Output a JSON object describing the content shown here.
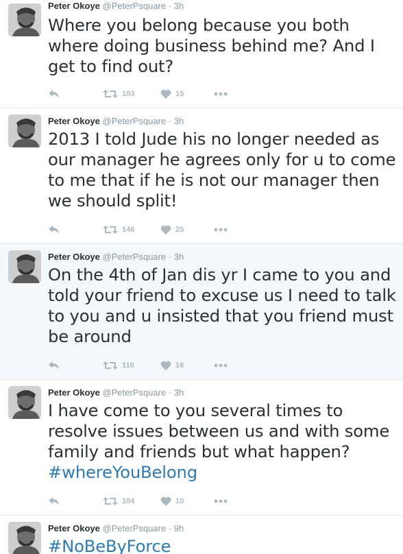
{
  "tweets": [
    {
      "fullname": "Peter Okoye",
      "username": "@PeterPsquare",
      "separator": "·",
      "time": "3h",
      "text": "Where you belong because you both where doing business behind me? And I get to find out?",
      "hashtag": "",
      "retweets": "103",
      "likes": "15"
    },
    {
      "fullname": "Peter Okoye",
      "username": "@PeterPsquare",
      "separator": "·",
      "time": "3h",
      "text": "2013 I told Jude his no longer needed as our manager he agrees only for u to come to me that if he is not our manager then we should split!",
      "hashtag": "",
      "retweets": "146",
      "likes": "25"
    },
    {
      "fullname": "Peter Okoye",
      "username": "@PeterPsquare",
      "separator": "·",
      "time": "3h",
      "text": "On the 4th of Jan dis yr I came to you and told your friend to excuse us I need to talk to you and u insisted that you friend must be around",
      "hashtag": "",
      "retweets": "110",
      "likes": "16"
    },
    {
      "fullname": "Peter Okoye",
      "username": "@PeterPsquare",
      "separator": "·",
      "time": "3h",
      "text": "I have come to you several times to resolve issues between us and with some family and friends but what happen?",
      "hashtag": "#whereYouBelong",
      "retweets": "104",
      "likes": "10"
    },
    {
      "fullname": "Peter Okoye",
      "username": "@PeterPsquare",
      "separator": "·",
      "time": "9h",
      "text": "",
      "hashtag": "#NoBeByForce",
      "retweets": "",
      "likes": ""
    }
  ],
  "colors": {
    "text": "#292f33",
    "muted": "#8899a6",
    "icon": "#aab8c2",
    "hashtag": "#2b7bb9",
    "highlight_bg": "#f5f8fa",
    "divider": "#e1e8ed"
  },
  "icons": [
    "avatar",
    "reply-icon",
    "retweet-icon",
    "heart-icon",
    "more-icon"
  ]
}
